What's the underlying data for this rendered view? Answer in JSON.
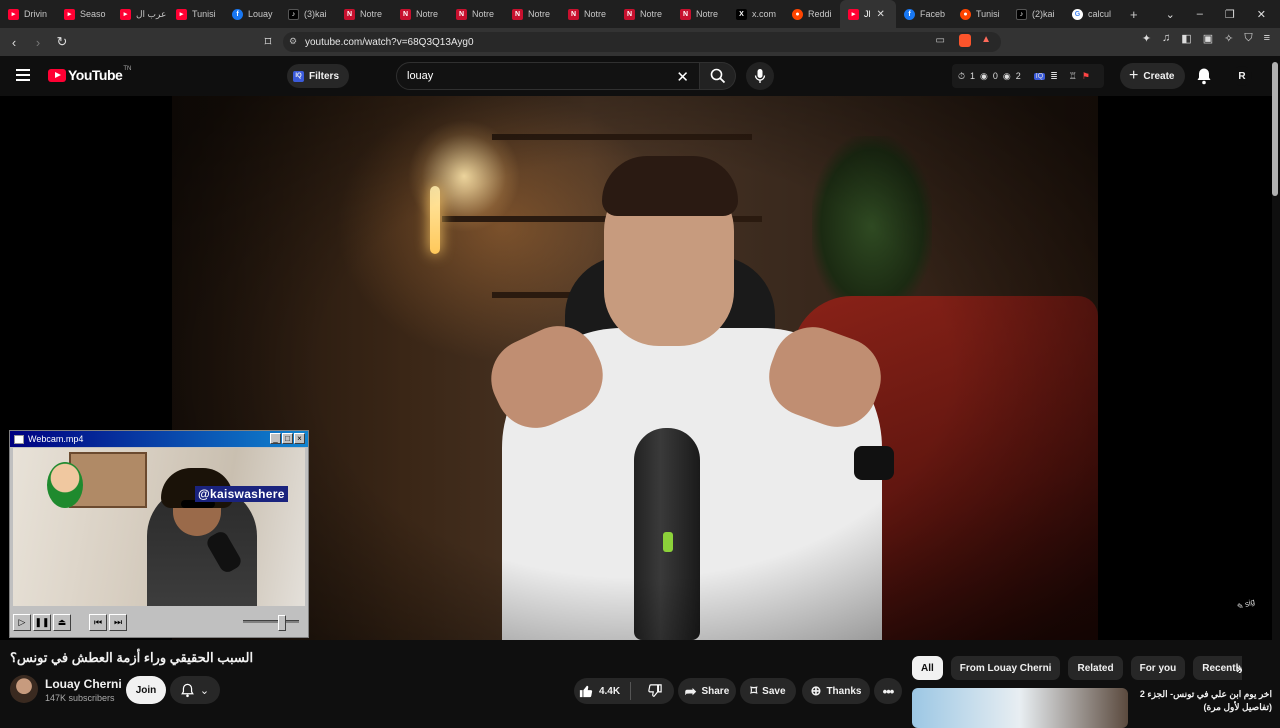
{
  "browser": {
    "tabs": [
      {
        "label": "Drivin",
        "icon": "youtube"
      },
      {
        "label": "Seaso",
        "icon": "youtube"
      },
      {
        "label": "عرب ال",
        "icon": "youtube"
      },
      {
        "label": "Tunisi",
        "icon": "youtube"
      },
      {
        "label": "Louay",
        "icon": "facebook"
      },
      {
        "label": "(3)kai",
        "icon": "tiktok"
      },
      {
        "label": "Notre",
        "icon": "notre-dame"
      },
      {
        "label": "Notre",
        "icon": "notre-dame"
      },
      {
        "label": "Notre",
        "icon": "notre-dame"
      },
      {
        "label": "Notre",
        "icon": "notre-dame"
      },
      {
        "label": "Notre",
        "icon": "notre-dame"
      },
      {
        "label": "Notre",
        "icon": "notre-dame"
      },
      {
        "label": "Notre",
        "icon": "notre-dame"
      },
      {
        "label": "x.com",
        "icon": "x"
      },
      {
        "label": "Reddi",
        "icon": "reddit"
      },
      {
        "label": "Jl",
        "icon": "youtube",
        "active": true
      },
      {
        "label": "Faceb",
        "icon": "facebook"
      },
      {
        "label": "Tunisi",
        "icon": "reddit"
      },
      {
        "label": "(2)kai",
        "icon": "tiktok"
      },
      {
        "label": "calcul",
        "icon": "google"
      }
    ],
    "url": "youtube.com/watch?v=68Q3Q13Ayg0"
  },
  "header": {
    "logo_text": "YouTube",
    "logo_tn": "TN",
    "filters_label": "Filters",
    "search_value": "louay",
    "stats": [
      "1",
      "0",
      "2"
    ],
    "create_label": "Create",
    "avatar_letter": "R"
  },
  "webcam": {
    "title": "Webcam.mp4",
    "handle": "@kaiswashere",
    "volume": 0.7
  },
  "video": {
    "title": "السبب الحقيقي وراء أزمة العطش في تونس؟",
    "channel_name": "Louay Cherni",
    "subscribers": "147K subscribers",
    "join_label": "Join",
    "likes": "4.4K",
    "share_label": "Share",
    "save_label": "Save",
    "thanks_label": "Thanks"
  },
  "recommendations": {
    "chips": [
      "All",
      "From Louay Cherni",
      "Related",
      "For you",
      "Recently uploaded"
    ],
    "active_chip": 0,
    "first_title": "اخر يوم ابن علي في تونس- الجزء 2 (تفاصيل لأول مرة)"
  },
  "colors": {
    "youtube_red": "#ff0033",
    "background": "#0f0f0f",
    "chip_bg": "#272727"
  }
}
